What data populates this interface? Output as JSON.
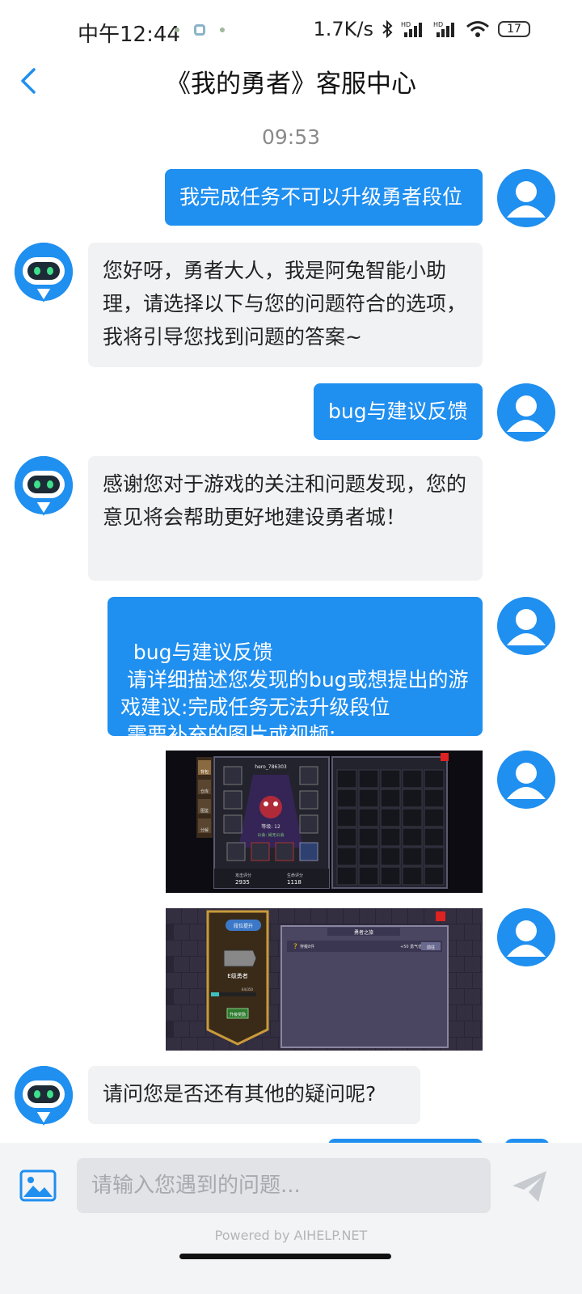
{
  "status_bar": {
    "time": "中午12:44",
    "network_speed": "1.7K/s",
    "battery": "17",
    "icons": [
      "bluetooth-icon",
      "signal-hd-icon",
      "signal-hd-icon",
      "wifi-icon",
      "battery-icon"
    ]
  },
  "header": {
    "back_icon": "chevron-left-icon",
    "title": "《我的勇者》客服中心"
  },
  "chat": {
    "timestamp": "09:53",
    "messages": [
      {
        "sender": "user",
        "text": "我完成任务不可以升级勇者段位"
      },
      {
        "sender": "bot",
        "text": "您好呀，勇者大人，我是阿兔智能小助理，请选择以下与您的问题符合的选项，我将引导您找到问题的答案~"
      },
      {
        "sender": "user",
        "text": "bug与建议反馈"
      },
      {
        "sender": "bot",
        "text": "感谢您对于游戏的关注和问题发现，您的意见将会帮助更好地建设勇者城！"
      },
      {
        "sender": "user",
        "text": "bug与建议反馈\n 请详细描述您发现的bug或想提出的游戏建议:完成任务无法升级段位\n 需要补充的图片或视频:"
      },
      {
        "sender": "user",
        "type": "image",
        "caption": "game-screenshot-inventory"
      },
      {
        "sender": "user",
        "type": "image",
        "caption": "game-screenshot-rank"
      },
      {
        "sender": "bot",
        "text": "请问您是否还有其他的疑问呢?"
      }
    ]
  },
  "screenshot1": {
    "hero_name": "hero_786303",
    "level_label": "等级: 12",
    "guild_label": "公会: 尚无公会",
    "stat1_label": "攻击评分",
    "stat1_value": "2935",
    "stat2_label": "生命评分",
    "stat2_value": "1118",
    "sidebar_tabs": [
      "背包",
      "仓库",
      "图鉴",
      "分解"
    ]
  },
  "screenshot2": {
    "rank_button": "段位提升",
    "rank_name": "E级勇者",
    "panel_title": "勇者之旅",
    "task_text": "穿戴8件",
    "task_reward": "+50 勇气值",
    "task_button": "前往",
    "progress_value": 0.18,
    "progress_fraction": "64/350",
    "upgrade_button": "升级奖励"
  },
  "input": {
    "placeholder": "请输入您遇到的问题...",
    "image_icon": "image-icon",
    "send_icon": "send-icon"
  },
  "footer": {
    "powered_by": "Powered by AIHELP.NET"
  },
  "colors": {
    "accent": "#1f8ff0",
    "bot_bubble": "#f1f2f4",
    "input_bg": "#f3f4f6"
  }
}
